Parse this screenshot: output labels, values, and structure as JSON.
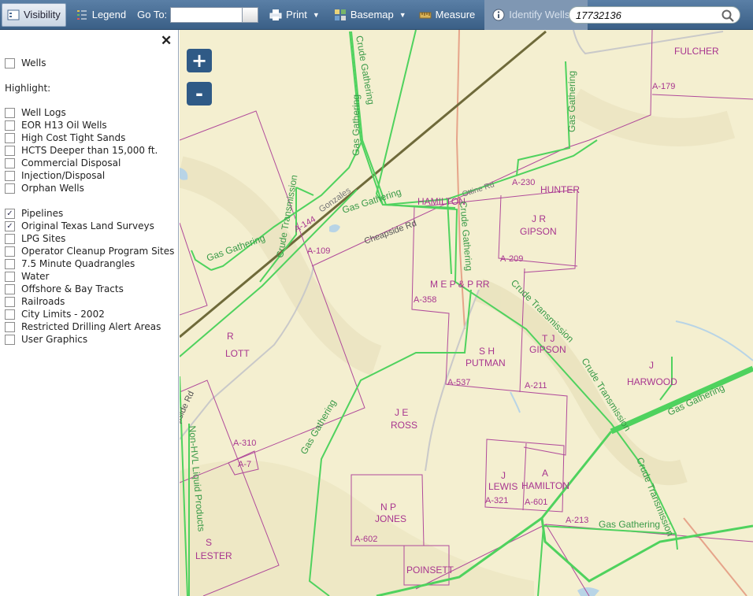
{
  "toolbar": {
    "visibility": "Visibility",
    "legend": "Legend",
    "goto_label": "Go To:",
    "goto_value": "",
    "print": "Print",
    "basemap": "Basemap",
    "measure": "Measure",
    "identify": "Identify Wells",
    "search_value": "17732136"
  },
  "sidebar": {
    "wells": "Wells",
    "highlight_label": "Highlight:",
    "highlight_items": [
      {
        "label": "Well Logs",
        "checked": false
      },
      {
        "label": "EOR H13 Oil Wells",
        "checked": false
      },
      {
        "label": "High Cost Tight Sands",
        "checked": false
      },
      {
        "label": "HCTS Deeper than 15,000 ft.",
        "checked": false
      },
      {
        "label": "Commercial Disposal",
        "checked": false
      },
      {
        "label": "Injection/Disposal",
        "checked": false
      },
      {
        "label": "Orphan Wells",
        "checked": false
      }
    ],
    "layer_items": [
      {
        "label": "Pipelines",
        "checked": true
      },
      {
        "label": "Original Texas Land Surveys",
        "checked": true
      },
      {
        "label": "LPG Sites",
        "checked": false
      },
      {
        "label": "Operator Cleanup Program Sites",
        "checked": false
      },
      {
        "label": "7.5 Minute Quadrangles",
        "checked": false
      },
      {
        "label": "Water",
        "checked": false
      },
      {
        "label": "Offshore & Bay Tracts",
        "checked": false
      },
      {
        "label": "Railroads",
        "checked": false
      },
      {
        "label": "City Limits - 2002",
        "checked": false
      },
      {
        "label": "Restricted Drilling Alert Areas",
        "checked": false
      },
      {
        "label": "User Graphics",
        "checked": false
      }
    ]
  },
  "map": {
    "zoom_in": "+",
    "zoom_out": "-",
    "labels": [
      "FULCHER",
      "A-179",
      "HUNTER",
      "A-230",
      "HAMILTON",
      "J R",
      "GIPSON",
      "A-209",
      "M E P & P RR",
      "A-358",
      "S H",
      "PUTMAN",
      "A-537",
      "T J",
      "GIPSON",
      "A-211",
      "J",
      "HARWOOD",
      "R",
      "LOTT",
      "J E",
      "ROSS",
      "A-310",
      "A-7",
      "J",
      "LEWIS",
      "A-321",
      "A",
      "HAMILTON",
      "A-601",
      "A-213",
      "N P",
      "JONES",
      "A-602",
      "POINSETT",
      "S",
      "LESTER",
      "A-144",
      "A-109"
    ],
    "line_labels": [
      "Gas Gathering",
      "Crude Transmission",
      "Gas Gathering",
      "Gas Gathering",
      "Gas Gathering",
      "Crude Gathering",
      "Crude Transmission",
      "Crude Transmission",
      "Gas Gathering",
      "Gas Gathering",
      "Non-HVL Liquid Products",
      "Cheapside Rd",
      "Gonzales",
      "Ottine Rd",
      "pside Rd",
      "Crude Transmission",
      "Gas Gathering",
      "Crude Gathering"
    ]
  }
}
